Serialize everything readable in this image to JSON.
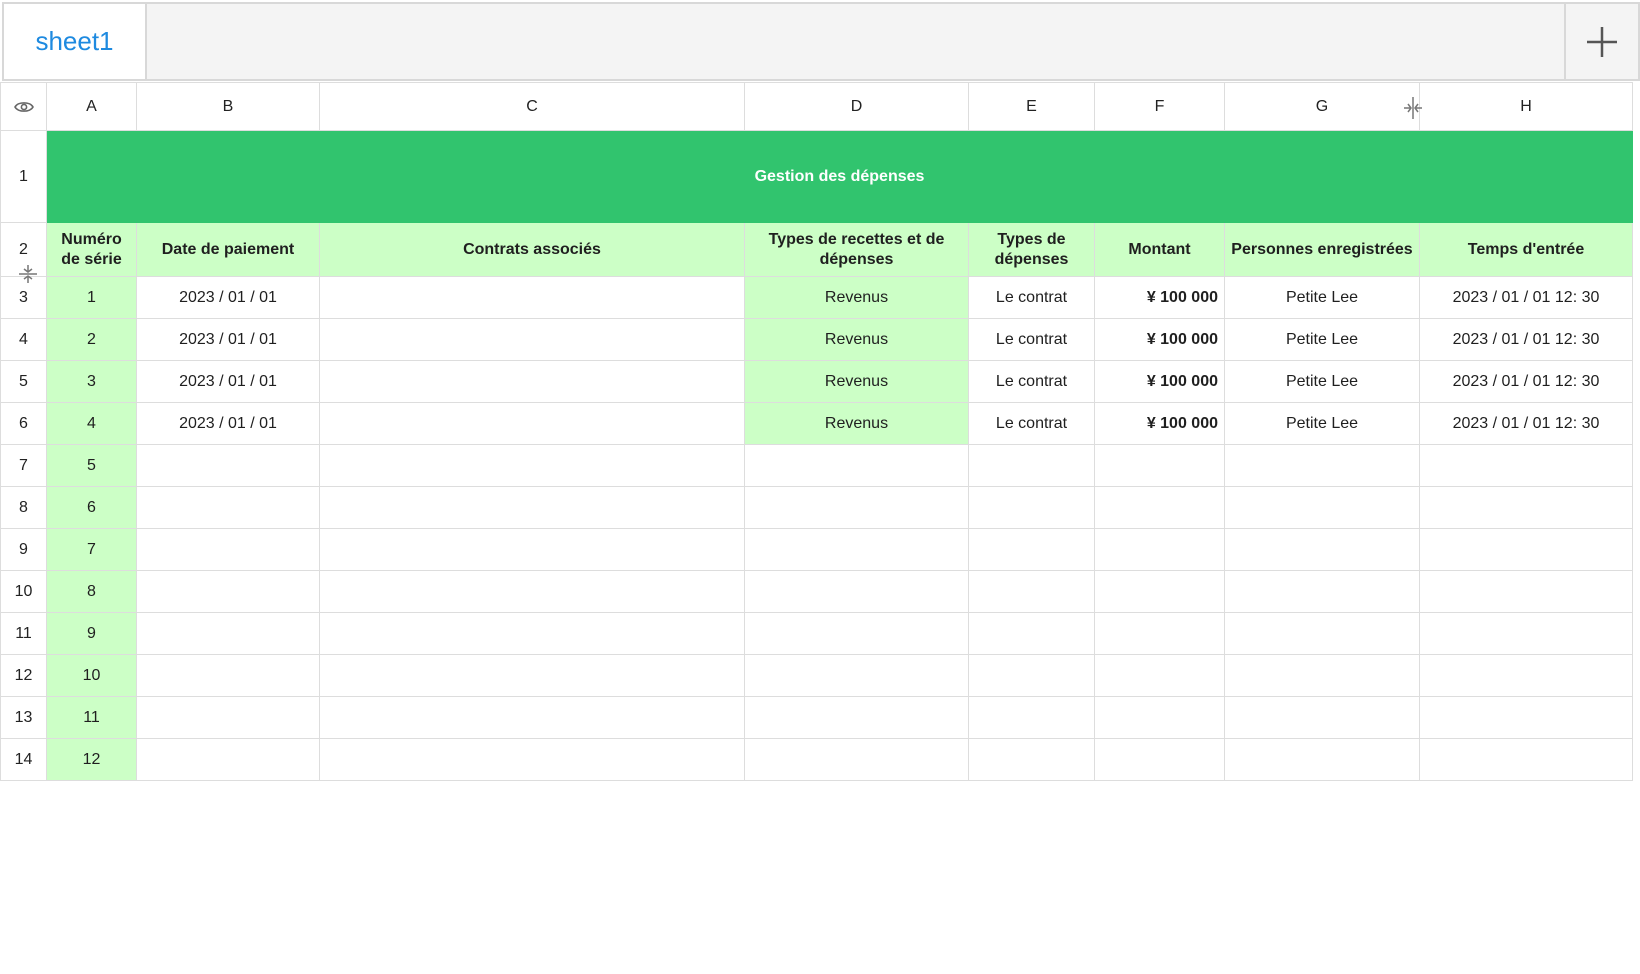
{
  "tabs": [
    {
      "label": "sheet1"
    }
  ],
  "add_tab_icon": "plus-icon",
  "columns": [
    "A",
    "B",
    "C",
    "D",
    "E",
    "F",
    "G",
    "H"
  ],
  "title": "Gestion des dépenses",
  "headers": [
    "Numéro de série",
    "Date de paiement",
    "Contrats associés",
    "Types de recettes et de dépenses",
    "Types de dépenses",
    "Montant",
    "Personnes enregistrées",
    "Temps d'entrée"
  ],
  "row_numbers": [
    "1",
    "2",
    "3",
    "4",
    "5",
    "6",
    "7",
    "8",
    "9",
    "10",
    "11",
    "12",
    "13",
    "14"
  ],
  "rows": [
    [
      "1",
      "2023 / 01 / 01",
      "",
      "Revenus",
      "Le contrat",
      "¥ 100 000",
      "Petite Lee",
      "2023 / 01 / 01 12: 30"
    ],
    [
      "2",
      "2023 / 01 / 01",
      "",
      "Revenus",
      "Le contrat",
      "¥ 100 000",
      "Petite Lee",
      "2023 / 01 / 01 12: 30"
    ],
    [
      "3",
      "2023 / 01 / 01",
      "",
      "Revenus",
      "Le contrat",
      "¥ 100 000",
      "Petite Lee",
      "2023 / 01 / 01 12: 30"
    ],
    [
      "4",
      "2023 / 01 / 01",
      "",
      "Revenus",
      "Le contrat",
      "¥ 100 000",
      "Petite Lee",
      "2023 / 01 / 01 12: 30"
    ],
    [
      "5",
      "",
      "",
      "",
      "",
      "",
      "",
      ""
    ],
    [
      "6",
      "",
      "",
      "",
      "",
      "",
      "",
      ""
    ],
    [
      "7",
      "",
      "",
      "",
      "",
      "",
      "",
      ""
    ],
    [
      "8",
      "",
      "",
      "",
      "",
      "",
      "",
      ""
    ],
    [
      "9",
      "",
      "",
      "",
      "",
      "",
      "",
      ""
    ],
    [
      "10",
      "",
      "",
      "",
      "",
      "",
      "",
      ""
    ],
    [
      "11",
      "",
      "",
      "",
      "",
      "",
      "",
      ""
    ],
    [
      "12",
      "",
      "",
      "",
      "",
      "",
      "",
      ""
    ]
  ],
  "colors": {
    "title_bg": "#31c46e",
    "header_bg": "#ccffc6",
    "tab_text": "#1e8ae0"
  },
  "icons": {
    "visibility": "eye-icon",
    "col_resize": "column-resize-icon",
    "row_resize": "row-resize-icon"
  }
}
